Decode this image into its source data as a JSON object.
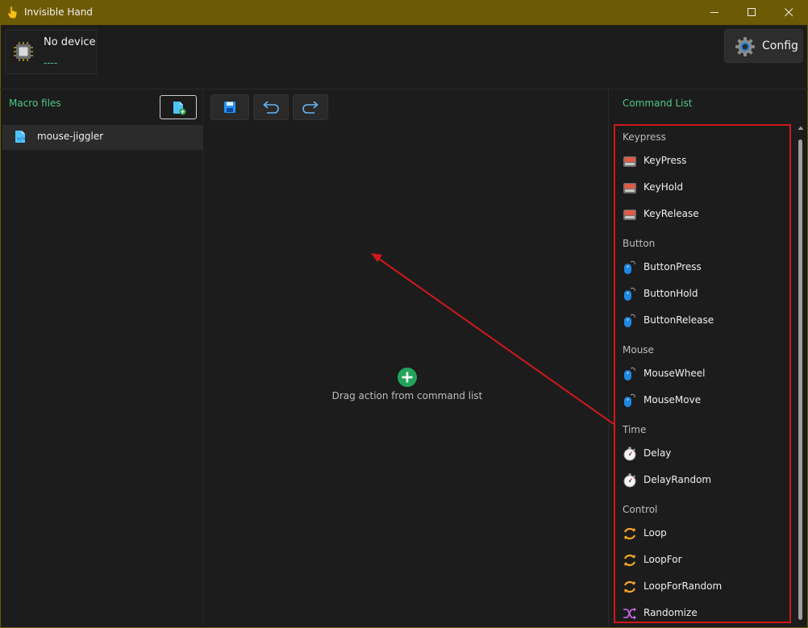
{
  "window": {
    "title": "Invisible Hand",
    "colors": {
      "titlebar": "#6d5a05",
      "accent_green": "#4fc78a",
      "highlight_red": "#d0181d"
    }
  },
  "device": {
    "name": "No device",
    "status": "----"
  },
  "config_button": {
    "label": "Config"
  },
  "macro_panel": {
    "title": "Macro files",
    "files": [
      {
        "name": "mouse-jiggler"
      }
    ]
  },
  "editor": {
    "empty_hint": "Drag action from command list"
  },
  "command_panel": {
    "title": "Command List",
    "groups": [
      {
        "label": "Keypress",
        "items": [
          {
            "label": "KeyPress",
            "icon": "keyboard-icon"
          },
          {
            "label": "KeyHold",
            "icon": "keyboard-icon"
          },
          {
            "label": "KeyRelease",
            "icon": "keyboard-icon"
          }
        ]
      },
      {
        "label": "Button",
        "items": [
          {
            "label": "ButtonPress",
            "icon": "mouse-icon"
          },
          {
            "label": "ButtonHold",
            "icon": "mouse-icon"
          },
          {
            "label": "ButtonRelease",
            "icon": "mouse-icon"
          }
        ]
      },
      {
        "label": "Mouse",
        "items": [
          {
            "label": "MouseWheel",
            "icon": "mouse-icon"
          },
          {
            "label": "MouseMove",
            "icon": "mouse-icon"
          }
        ]
      },
      {
        "label": "Time",
        "items": [
          {
            "label": "Delay",
            "icon": "stopwatch-icon"
          },
          {
            "label": "DelayRandom",
            "icon": "stopwatch-icon"
          }
        ]
      },
      {
        "label": "Control",
        "items": [
          {
            "label": "Loop",
            "icon": "loop-icon"
          },
          {
            "label": "LoopFor",
            "icon": "loop-icon"
          },
          {
            "label": "LoopForRandom",
            "icon": "loop-icon"
          },
          {
            "label": "Randomize",
            "icon": "shuffle-icon"
          }
        ]
      }
    ]
  }
}
